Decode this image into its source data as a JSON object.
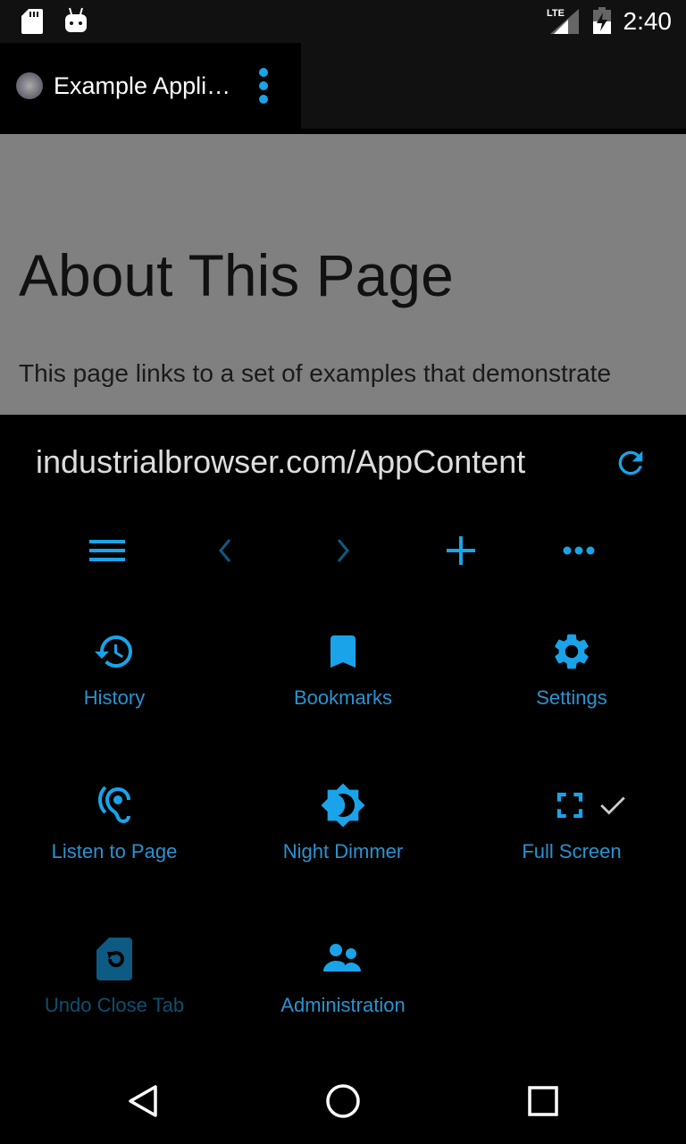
{
  "status_bar": {
    "time": "2:40",
    "network": "LTE",
    "icons": [
      "sd-card-icon",
      "android-icon",
      "signal-icon",
      "battery-charging-icon"
    ]
  },
  "tab": {
    "title": "Example Appli…",
    "icon": "globe-icon",
    "menu_icon": "kebab-icon"
  },
  "page": {
    "heading": "About This Page",
    "body": "This page links to a set of examples that demonstrate"
  },
  "menu": {
    "url": "industrialbrowser.com/AppContent",
    "accent": "#1aa3e8",
    "toolbar": [
      "menu-icon",
      "back-icon",
      "forward-icon",
      "add-tab-icon",
      "more-icon"
    ],
    "items": [
      {
        "label": "History",
        "icon": "history-icon",
        "enabled": true
      },
      {
        "label": "Bookmarks",
        "icon": "bookmark-icon",
        "enabled": true
      },
      {
        "label": "Settings",
        "icon": "gear-icon",
        "enabled": true
      },
      {
        "label": "Listen to Page",
        "icon": "ear-icon",
        "enabled": true
      },
      {
        "label": "Night Dimmer",
        "icon": "brightness-icon",
        "enabled": true
      },
      {
        "label": "Full Screen",
        "icon": "fullscreen-icon",
        "enabled": true,
        "checked": true
      },
      {
        "label": "Undo Close Tab",
        "icon": "restore-page-icon",
        "enabled": false
      },
      {
        "label": "Administration",
        "icon": "people-icon",
        "enabled": true
      }
    ]
  }
}
